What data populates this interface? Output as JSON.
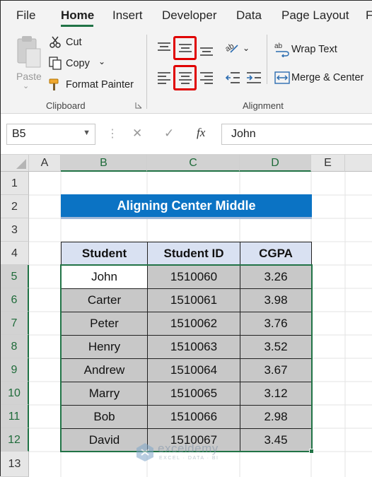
{
  "menu": {
    "tabs": [
      "File",
      "Home",
      "Insert",
      "Developer",
      "Data",
      "Page Layout",
      "F"
    ],
    "active": "Home"
  },
  "clipboard": {
    "paste": "Paste",
    "cut": "Cut",
    "copy": "Copy",
    "format_painter": "Format Painter",
    "group_label": "Clipboard"
  },
  "alignment": {
    "wrap_text": "Wrap Text",
    "merge_center": "Merge & Center",
    "group_label": "Alignment",
    "highlighted": [
      "Middle Align",
      "Center"
    ]
  },
  "formula_bar": {
    "name_box": "B5",
    "cancel": "✕",
    "enter": "✓",
    "fx": "fx",
    "value": "John"
  },
  "sheet": {
    "columns": [
      "A",
      "B",
      "C",
      "D",
      "E"
    ],
    "rows": [
      "1",
      "2",
      "3",
      "4",
      "5",
      "6",
      "7",
      "8",
      "9",
      "10",
      "11",
      "12",
      "13"
    ],
    "title": "Aligning Center Middle",
    "headers": [
      "Student",
      "Student ID",
      "CGPA"
    ],
    "data": [
      [
        "John",
        "1510060",
        "3.26"
      ],
      [
        "Carter",
        "1510061",
        "3.98"
      ],
      [
        "Peter",
        "1510062",
        "3.76"
      ],
      [
        "Henry",
        "1510063",
        "3.52"
      ],
      [
        "Andrew",
        "1510064",
        "3.67"
      ],
      [
        "Marry",
        "1510065",
        "3.12"
      ],
      [
        "Bob",
        "1510066",
        "2.98"
      ],
      [
        "David",
        "1510067",
        "3.45"
      ]
    ],
    "selection": "B5:D12",
    "active_cell": "B5"
  },
  "watermark": {
    "brand": "exceldemy",
    "tagline": "EXCEL · DATA · BI"
  },
  "colors": {
    "accent": "#217346",
    "title_fill": "#0b73c4",
    "header_fill": "#d9e1f2",
    "selection_fill": "#c8c8c8",
    "highlight_box": "#e00000"
  }
}
